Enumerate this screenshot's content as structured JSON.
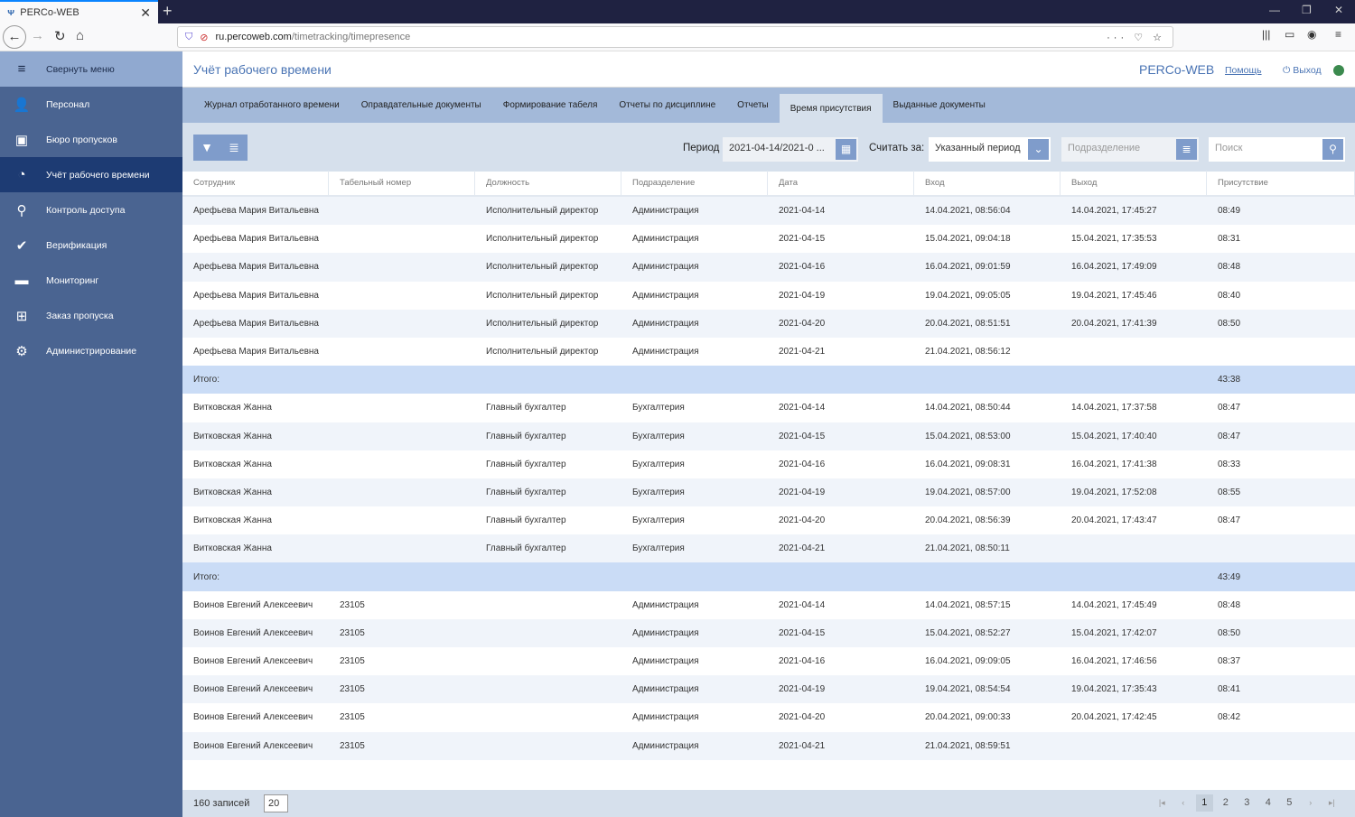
{
  "browser": {
    "tab_title": "PERCo-WEB",
    "url_domain": "ru.percoweb.com",
    "url_path": "/timetracking/timepresence"
  },
  "sidebar": {
    "items": [
      {
        "label": "Свернуть меню",
        "icon": "hamburger-icon"
      },
      {
        "label": "Персонал",
        "icon": "person-icon"
      },
      {
        "label": "Бюро пропусков",
        "icon": "badge-icon"
      },
      {
        "label": "Учёт рабочего времени",
        "icon": "clock-person-icon"
      },
      {
        "label": "Контроль доступа",
        "icon": "key-icon"
      },
      {
        "label": "Верификация",
        "icon": "verify-icon"
      },
      {
        "label": "Мониторинг",
        "icon": "monitor-icon"
      },
      {
        "label": "Заказ пропуска",
        "icon": "order-pass-icon"
      },
      {
        "label": "Администрирование",
        "icon": "gear-icon"
      }
    ],
    "active": 3
  },
  "header": {
    "title": "Учёт рабочего времени",
    "brand": "PERCo-WEB",
    "help": "Помощь",
    "logout": "Выход",
    "status_color": "#3b8a4e"
  },
  "tabs": [
    "Журнал отработанного времени",
    "Оправдательные документы",
    "Формирование табеля",
    "Отчеты по дисциплине",
    "Отчеты",
    "Время присутствия",
    "Выданные документы"
  ],
  "active_tab": 5,
  "toolbar": {
    "period_label": "Период",
    "period_value": "2021-04-14/2021-0 ...",
    "count_label": "Считать за:",
    "count_value": "Указанный период",
    "division_placeholder": "Подразделение",
    "search_placeholder": "Поиск"
  },
  "table": {
    "columns": [
      "Сотрудник",
      "Табельный номер",
      "Должность",
      "Подразделение",
      "Дата",
      "Вход",
      "Выход",
      "Присутствие"
    ],
    "rows": [
      [
        "Арефьева Мария Витальевна",
        "",
        "Исполнительный директор",
        "Администрация",
        "2021-04-14",
        "14.04.2021, 08:56:04",
        "14.04.2021, 17:45:27",
        "08:49"
      ],
      [
        "Арефьева Мария Витальевна",
        "",
        "Исполнительный директор",
        "Администрация",
        "2021-04-15",
        "15.04.2021, 09:04:18",
        "15.04.2021, 17:35:53",
        "08:31"
      ],
      [
        "Арефьева Мария Витальевна",
        "",
        "Исполнительный директор",
        "Администрация",
        "2021-04-16",
        "16.04.2021, 09:01:59",
        "16.04.2021, 17:49:09",
        "08:48"
      ],
      [
        "Арефьева Мария Витальевна",
        "",
        "Исполнительный директор",
        "Администрация",
        "2021-04-19",
        "19.04.2021, 09:05:05",
        "19.04.2021, 17:45:46",
        "08:40"
      ],
      [
        "Арефьева Мария Витальевна",
        "",
        "Исполнительный директор",
        "Администрация",
        "2021-04-20",
        "20.04.2021, 08:51:51",
        "20.04.2021, 17:41:39",
        "08:50"
      ],
      [
        "Арефьева Мария Витальевна",
        "",
        "Исполнительный директор",
        "Администрация",
        "2021-04-21",
        "21.04.2021, 08:56:12",
        "",
        ""
      ],
      [
        "Итого:",
        "",
        "",
        "",
        "",
        "",
        "",
        "43:38"
      ],
      [
        "Витковская Жанна",
        "",
        "Главный бухгалтер",
        "Бухгалтерия",
        "2021-04-14",
        "14.04.2021, 08:50:44",
        "14.04.2021, 17:37:58",
        "08:47"
      ],
      [
        "Витковская Жанна",
        "",
        "Главный бухгалтер",
        "Бухгалтерия",
        "2021-04-15",
        "15.04.2021, 08:53:00",
        "15.04.2021, 17:40:40",
        "08:47"
      ],
      [
        "Витковская Жанна",
        "",
        "Главный бухгалтер",
        "Бухгалтерия",
        "2021-04-16",
        "16.04.2021, 09:08:31",
        "16.04.2021, 17:41:38",
        "08:33"
      ],
      [
        "Витковская Жанна",
        "",
        "Главный бухгалтер",
        "Бухгалтерия",
        "2021-04-19",
        "19.04.2021, 08:57:00",
        "19.04.2021, 17:52:08",
        "08:55"
      ],
      [
        "Витковская Жанна",
        "",
        "Главный бухгалтер",
        "Бухгалтерия",
        "2021-04-20",
        "20.04.2021, 08:56:39",
        "20.04.2021, 17:43:47",
        "08:47"
      ],
      [
        "Витковская Жанна",
        "",
        "Главный бухгалтер",
        "Бухгалтерия",
        "2021-04-21",
        "21.04.2021, 08:50:11",
        "",
        ""
      ],
      [
        "Итого:",
        "",
        "",
        "",
        "",
        "",
        "",
        "43:49"
      ],
      [
        "Воинов Евгений Алексеевич",
        "23105",
        "",
        "Администрация",
        "2021-04-14",
        "14.04.2021, 08:57:15",
        "14.04.2021, 17:45:49",
        "08:48"
      ],
      [
        "Воинов Евгений Алексеевич",
        "23105",
        "",
        "Администрация",
        "2021-04-15",
        "15.04.2021, 08:52:27",
        "15.04.2021, 17:42:07",
        "08:50"
      ],
      [
        "Воинов Евгений Алексеевич",
        "23105",
        "",
        "Администрация",
        "2021-04-16",
        "16.04.2021, 09:09:05",
        "16.04.2021, 17:46:56",
        "08:37"
      ],
      [
        "Воинов Евгений Алексеевич",
        "23105",
        "",
        "Администрация",
        "2021-04-19",
        "19.04.2021, 08:54:54",
        "19.04.2021, 17:35:43",
        "08:41"
      ],
      [
        "Воинов Евгений Алексеевич",
        "23105",
        "",
        "Администрация",
        "2021-04-20",
        "20.04.2021, 09:00:33",
        "20.04.2021, 17:42:45",
        "08:42"
      ],
      [
        "Воинов Евгений Алексеевич",
        "23105",
        "",
        "Администрация",
        "2021-04-21",
        "21.04.2021, 08:59:51",
        "",
        ""
      ]
    ]
  },
  "footer": {
    "records": "160 записей",
    "page_size": "20",
    "pages": [
      "1",
      "2",
      "3",
      "4",
      "5"
    ],
    "current_page": "1"
  }
}
